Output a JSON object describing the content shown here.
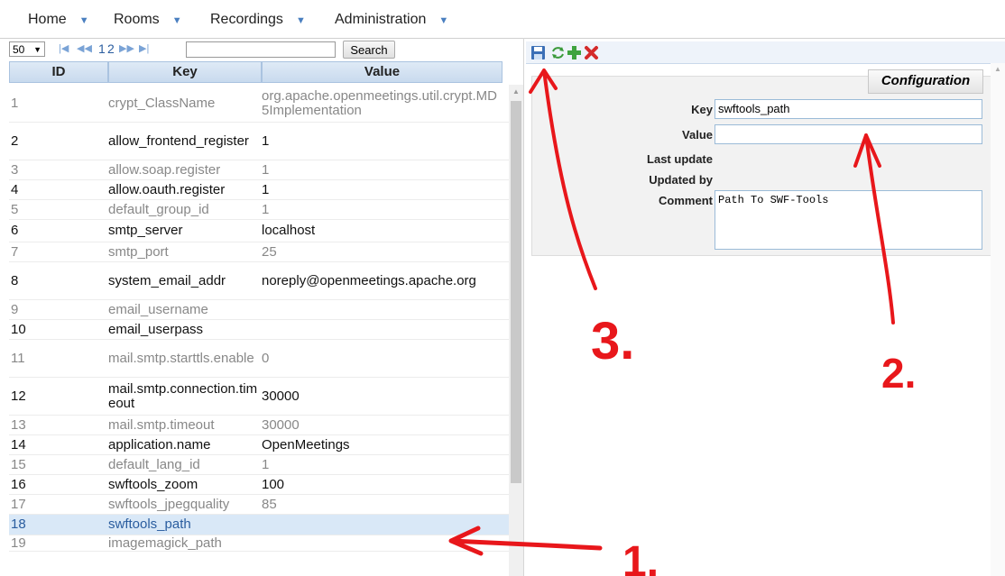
{
  "menu": [
    {
      "label": "Home"
    },
    {
      "label": "Rooms"
    },
    {
      "label": "Recordings"
    },
    {
      "label": "Administration"
    }
  ],
  "pager": {
    "page_size": "50",
    "pages": [
      "1",
      "2"
    ],
    "search_label": "Search",
    "filter_value": ""
  },
  "table": {
    "headers": [
      "ID",
      "Key",
      "Value"
    ],
    "rows": [
      {
        "id": "1",
        "key": "crypt_ClassName",
        "value": "org.apache.openmeetings.util.crypt.MD5Implementation"
      },
      {
        "id": "2",
        "key": "allow_frontend_register",
        "value": "1"
      },
      {
        "id": "3",
        "key": "allow.soap.register",
        "value": "1"
      },
      {
        "id": "4",
        "key": "allow.oauth.register",
        "value": "1"
      },
      {
        "id": "5",
        "key": "default_group_id",
        "value": "1"
      },
      {
        "id": "6",
        "key": "smtp_server",
        "value": "localhost"
      },
      {
        "id": "7",
        "key": "smtp_port",
        "value": "25"
      },
      {
        "id": "8",
        "key": "system_email_addr",
        "value": "noreply@openmeetings.apache.org"
      },
      {
        "id": "9",
        "key": "email_username",
        "value": ""
      },
      {
        "id": "10",
        "key": "email_userpass",
        "value": ""
      },
      {
        "id": "11",
        "key": "mail.smtp.starttls.enable",
        "value": "0"
      },
      {
        "id": "12",
        "key": "mail.smtp.connection.timeout",
        "value": "30000"
      },
      {
        "id": "13",
        "key": "mail.smtp.timeout",
        "value": "30000"
      },
      {
        "id": "14",
        "key": "application.name",
        "value": "OpenMeetings"
      },
      {
        "id": "15",
        "key": "default_lang_id",
        "value": "1"
      },
      {
        "id": "16",
        "key": "swftools_zoom",
        "value": "100"
      },
      {
        "id": "17",
        "key": "swftools_jpegquality",
        "value": "85"
      },
      {
        "id": "18",
        "key": "swftools_path",
        "value": ""
      },
      {
        "id": "19",
        "key": "imagemagick_path",
        "value": ""
      }
    ]
  },
  "toolbar": {
    "icons": [
      "save-icon",
      "refresh-icon",
      "add-icon",
      "delete-icon"
    ]
  },
  "config": {
    "title": "Configuration",
    "key_label": "Key",
    "key_value": "swftools_path",
    "value_label": "Value",
    "value_value": "",
    "last_update_label": "Last update",
    "updated_by_label": "Updated by",
    "comment_label": "Comment",
    "comment_value": "Path To SWF-Tools"
  },
  "annotations": {
    "labels": [
      "3.",
      "2.",
      "1."
    ],
    "color": "#e8171b"
  }
}
